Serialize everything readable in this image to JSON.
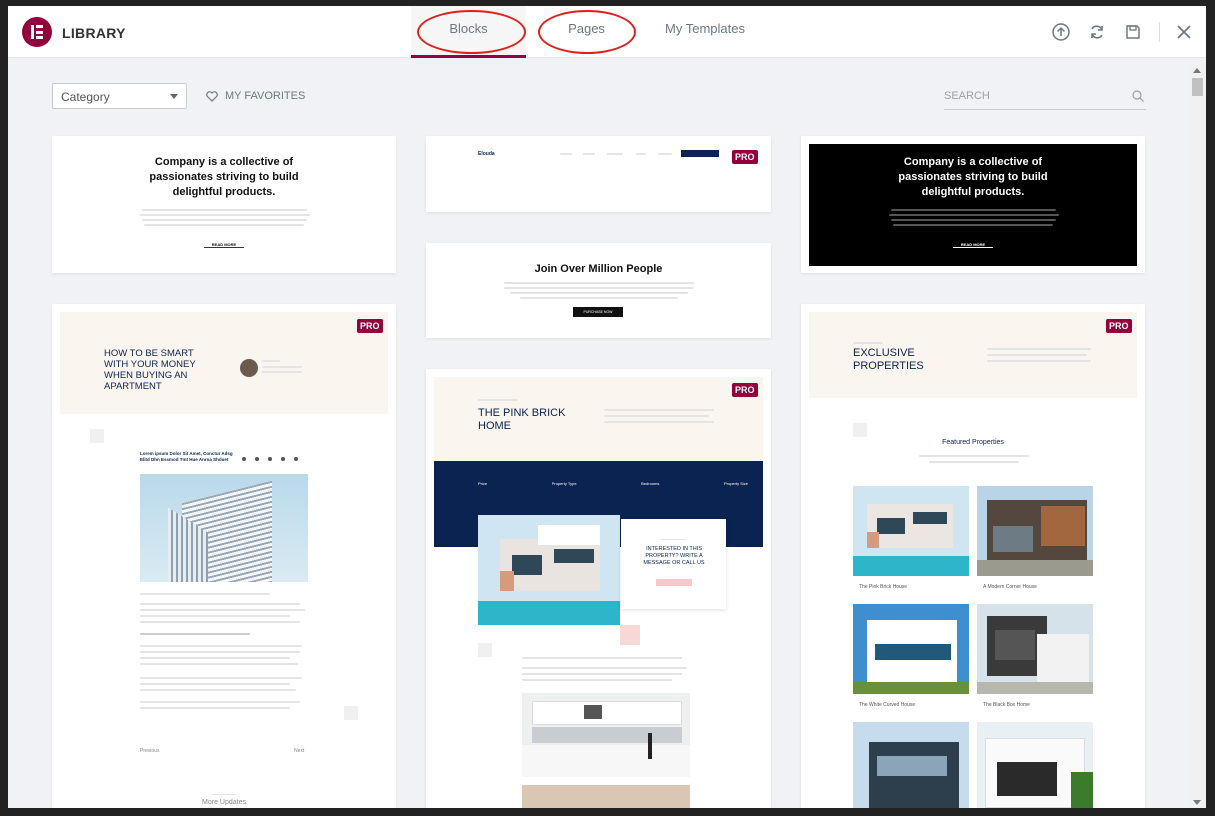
{
  "header": {
    "title": "LIBRARY",
    "tabs": [
      {
        "label": "Blocks",
        "active": true
      },
      {
        "label": "Pages",
        "active": false
      },
      {
        "label": "My Templates",
        "active": false
      }
    ],
    "icons": [
      "upload-icon",
      "sync-icon",
      "save-icon",
      "close-icon"
    ]
  },
  "toolbar": {
    "category_value": "Category",
    "favorites_label": "MY FAVORITES",
    "search_placeholder": "SEARCH"
  },
  "badge_label": "PRO",
  "cards": {
    "c1": {
      "heading": "Company is a collective of passionates striving to build delightful products.",
      "link": "READ MORE"
    },
    "c2": {
      "brand": "Elouda"
    },
    "c3": {
      "heading": "Company is a collective of passionates striving to build delightful products.",
      "link": "READ MORE"
    },
    "c4": {
      "heading": "Join Over Million People",
      "button": "PURCHASE NOW"
    },
    "c5": {
      "title": "HOW TO BE SMART WITH YOUR MONEY WHEN BUYING AN APARTMENT",
      "post_title": "Lorem ipsum Dolor Sit Amet, Conctur Adsg Elitd Dhn Essmod Tmt Hue Anrna Shduet",
      "prev": "Previous",
      "next": "Next",
      "footer": "More Updates"
    },
    "c6": {
      "title": "THE PINK BRICK HOME",
      "stats": [
        "Price",
        "Property Type",
        "Bedrooms",
        "Property Size"
      ],
      "callout": "INTERESTED IN THIS PROPERTY? WRITE A MESSAGE OR CALL US"
    },
    "c7": {
      "title": "EXCLUSIVE PROPERTIES",
      "section": "Featured Properties",
      "props": [
        "The Pink Brick House",
        "A Modern Corner House",
        "The White Curved House",
        "The Black Box Home"
      ]
    }
  },
  "colors": {
    "accent": "#93003c",
    "navy": "#0a2351",
    "peach": "#fbf5ef"
  }
}
